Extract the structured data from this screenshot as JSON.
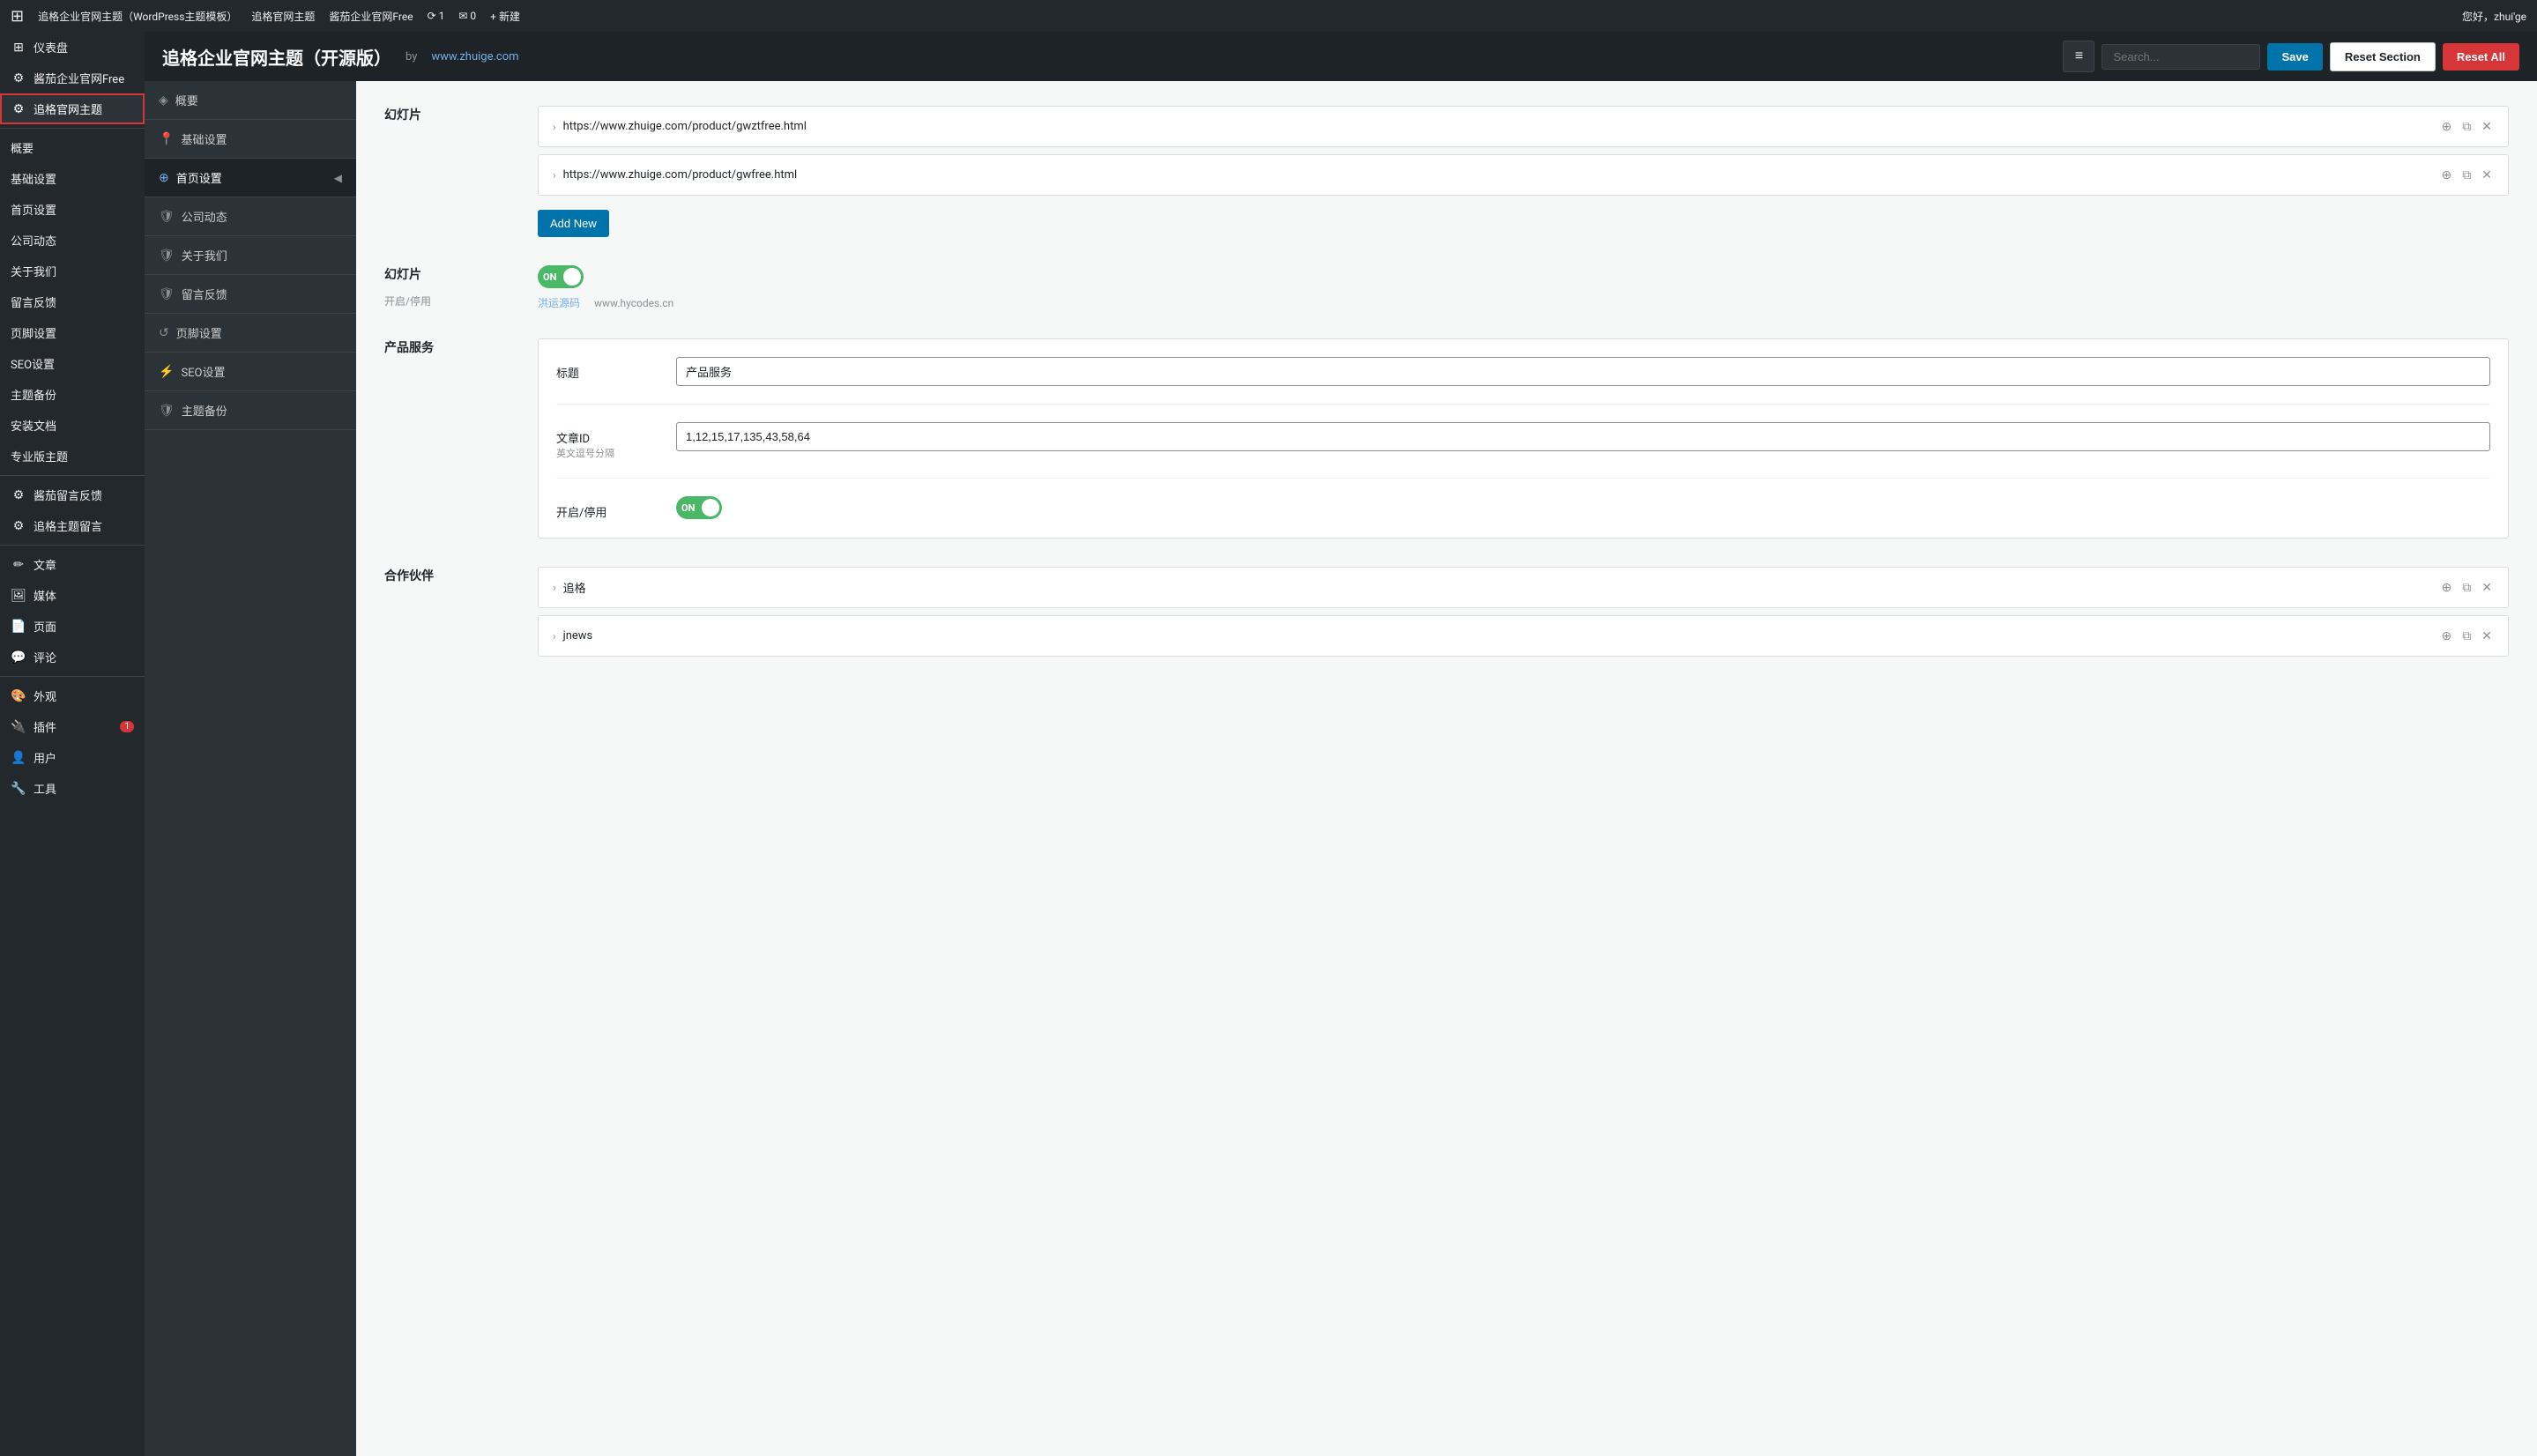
{
  "adminbar": {
    "logo": "⊞",
    "items": [
      {
        "label": "追格企业官网主题（WordPress主题模板）"
      },
      {
        "label": "追格官网主题"
      },
      {
        "label": "酱茄企业官网Free"
      },
      {
        "label": "⟳ 1"
      },
      {
        "label": "✉ 0"
      },
      {
        "label": "+ 新建"
      }
    ],
    "greeting": "您好，zhui'ge"
  },
  "customizer": {
    "title": "追格企业官网主题（开源版）",
    "by_label": "by",
    "by_url": "www.zhuige.com",
    "search_placeholder": "Search...",
    "btn_save": "Save",
    "btn_reset_section": "Reset Section",
    "btn_reset_all": "Reset All"
  },
  "sidebar": {
    "items": [
      {
        "label": "仪表盘",
        "icon": "⊞"
      },
      {
        "label": "酱茄企业官网Free",
        "icon": "⚙"
      },
      {
        "label": "追格官网主题",
        "icon": "⚙",
        "active": true
      },
      {
        "label": "概要"
      },
      {
        "label": "基础设置"
      },
      {
        "label": "首页设置"
      },
      {
        "label": "公司动态"
      },
      {
        "label": "关于我们"
      },
      {
        "label": "留言反馈"
      },
      {
        "label": "页脚设置"
      },
      {
        "label": "SEO设置"
      },
      {
        "label": "主题备份"
      },
      {
        "label": "安装文档"
      },
      {
        "label": "专业版主题"
      },
      {
        "label": "酱茄留言反馈",
        "icon": "⚙"
      },
      {
        "label": "追格主题留言",
        "icon": "⚙"
      },
      {
        "label": "文章",
        "icon": "✏"
      },
      {
        "label": "媒体",
        "icon": "🖼"
      },
      {
        "label": "页面",
        "icon": "📄"
      },
      {
        "label": "评论",
        "icon": "💬"
      },
      {
        "label": "外观",
        "icon": "🎨"
      },
      {
        "label": "插件",
        "icon": "🔌",
        "badge": "1"
      },
      {
        "label": "用户",
        "icon": "👤"
      },
      {
        "label": "工具",
        "icon": "🔧"
      }
    ]
  },
  "panel": {
    "items": [
      {
        "label": "概要",
        "icon": "◈"
      },
      {
        "label": "基础设置",
        "icon": "📍"
      },
      {
        "label": "首页设置",
        "icon": "⊕",
        "active": true
      },
      {
        "label": "公司动态",
        "icon": "🛡"
      },
      {
        "label": "关于我们",
        "icon": "🛡"
      },
      {
        "label": "留言反馈",
        "icon": "🛡"
      },
      {
        "label": "页脚设置",
        "icon": "↺"
      },
      {
        "label": "SEO设置",
        "icon": "⚡"
      },
      {
        "label": "主题备份",
        "icon": "🛡"
      }
    ]
  },
  "content": {
    "slideshow_section": {
      "label": "幻灯片",
      "items": [
        {
          "url": "https://www.zhuige.com/product/gwztfree.html"
        },
        {
          "url": "https://www.zhuige.com/product/gwfree.html"
        }
      ],
      "add_new_label": "Add New"
    },
    "slideshow_toggle_section": {
      "label": "幻灯片",
      "sublabel": "开启/停用",
      "toggle_on": "ON",
      "watermark_label": "洪运源码",
      "watermark_url": "www.hycodes.cn"
    },
    "product_service_section": {
      "label": "产品服务",
      "fields": [
        {
          "label": "标题",
          "sublabel": "",
          "value": "产品服务",
          "type": "text"
        },
        {
          "label": "文章ID",
          "sublabel": "英文逗号分隔",
          "value": "1,12,15,17,135,43,58,64",
          "type": "text"
        },
        {
          "label": "开启/停用",
          "sublabel": "",
          "toggle_on": "ON",
          "type": "toggle"
        }
      ]
    },
    "partners_section": {
      "label": "合作伙伴",
      "items": [
        {
          "name": "追格"
        },
        {
          "name": "jnews"
        }
      ]
    }
  }
}
